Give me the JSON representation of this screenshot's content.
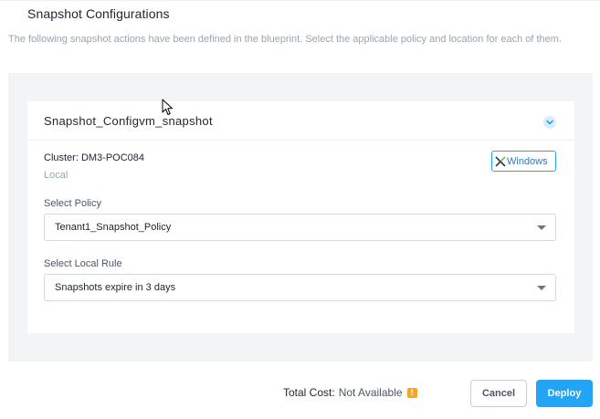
{
  "header": {
    "title": "Snapshot Configurations",
    "description": "The following snapshot actions have been defined in the blueprint. Select the applicable policy and location for each of them."
  },
  "card": {
    "title": "Snapshot_Configvm_snapshot",
    "cluster_label": "Cluster: DM3-POC084",
    "cluster_location": "Local",
    "os_badge": "Windows",
    "policy_label": "Select Policy",
    "policy_value": "Tenant1_Snapshot_Policy",
    "rule_label": "Select Local Rule",
    "rule_value": "Snapshots expire in 3 days"
  },
  "footer": {
    "cost_label": "Total Cost:",
    "cost_value": "Not Available",
    "cancel_label": "Cancel",
    "deploy_label": "Deploy"
  },
  "icons": {
    "collapse": "chevron-down-icon",
    "os": "nutanix-x-icon",
    "warning": "warning-icon",
    "cursor": "mouse-pointer-icon"
  },
  "colors": {
    "accent": "#22a5f7",
    "warning": "#f5a623",
    "panel_bg": "#f2f4f6"
  }
}
